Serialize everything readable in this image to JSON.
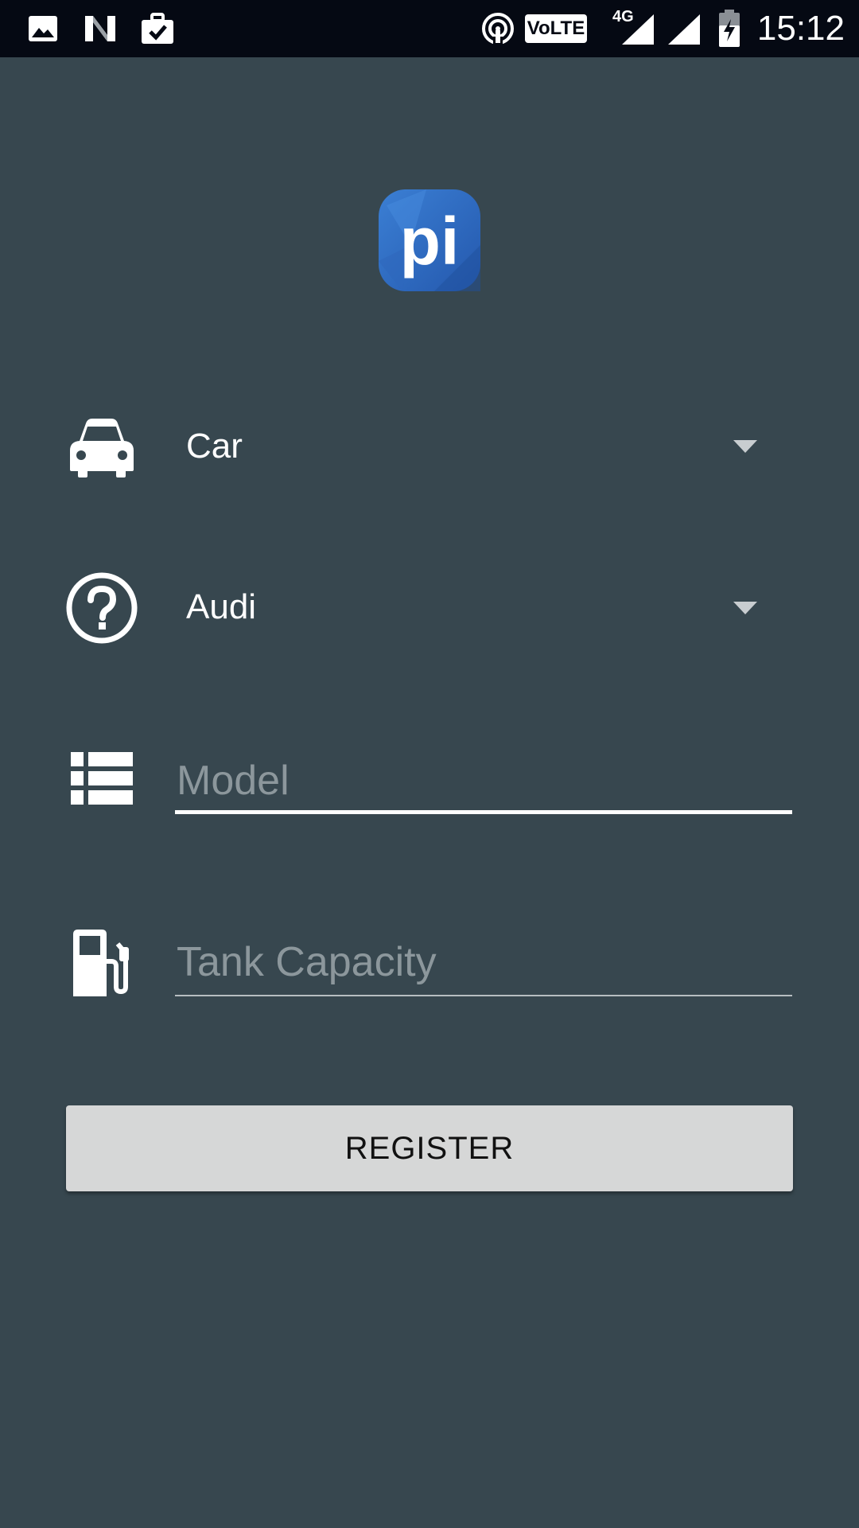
{
  "status_bar": {
    "time": "15:12",
    "volte_label": "VoLTE",
    "network_label": "4G",
    "left_icons": [
      "image-icon",
      "n-notification-icon",
      "briefcase-check-icon"
    ],
    "right_icons": [
      "hotspot-icon",
      "volte-icon",
      "signal-4g-icon",
      "signal-icon",
      "battery-charging-icon"
    ]
  },
  "logo": {
    "text": "pi",
    "color": "#2f6fc6"
  },
  "form": {
    "vehicle_type": {
      "icon": "car-icon",
      "selected": "Car"
    },
    "brand": {
      "icon": "help-circle-icon",
      "selected": "Audi"
    },
    "model": {
      "icon": "list-icon",
      "placeholder": "Model",
      "value": ""
    },
    "tank_capacity": {
      "icon": "fuel-pump-icon",
      "placeholder": "Tank Capacity",
      "value": ""
    },
    "register_label": "REGISTER"
  },
  "colors": {
    "background": "#37474f",
    "status_bar": "#050913",
    "button": "#d6d7d7",
    "placeholder": "#8c979c"
  }
}
